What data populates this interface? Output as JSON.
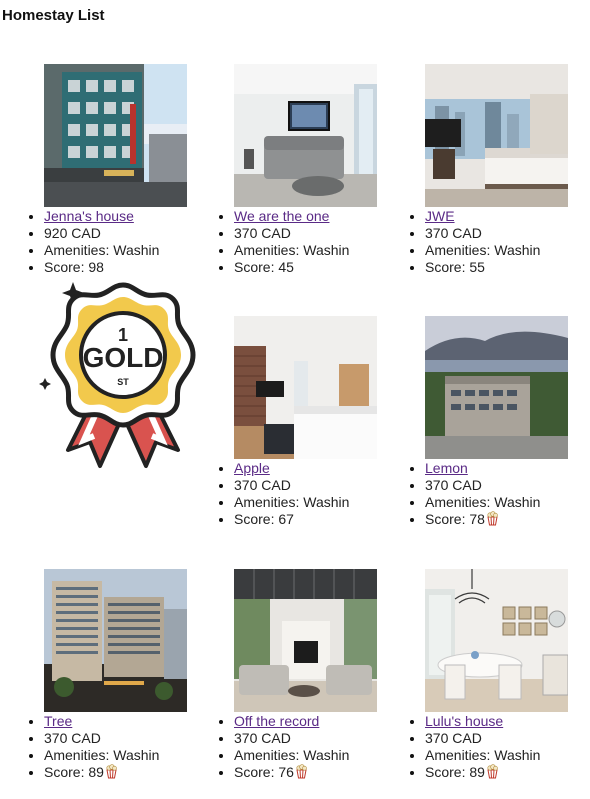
{
  "page": {
    "title": "Homestay List"
  },
  "listings": [
    {
      "name": "Jenna's house",
      "price": "920 CAD",
      "amenities": "Amenities: Washin",
      "score": "Score: 98",
      "badge": false,
      "image": "storefront-building"
    },
    {
      "name": "We are the one",
      "price": "370 CAD",
      "amenities": "Amenities: Washin",
      "score": "Score: 45",
      "badge": false,
      "image": "living-room"
    },
    {
      "name": "JWE",
      "price": "370 CAD",
      "amenities": "Amenities: Washin",
      "score": "Score: 55",
      "badge": false,
      "image": "bedroom-city-view"
    },
    {
      "name": "Apple",
      "price": "370 CAD",
      "amenities": "Amenities: Washin",
      "score": "Score: 67",
      "badge": false,
      "image": "bedroom-brick"
    },
    {
      "name": "Lemon",
      "price": "370 CAD",
      "amenities": "Amenities: Washin",
      "score": "Score: 78",
      "badge": true,
      "image": "aerial-building"
    },
    {
      "name": "Tree",
      "price": "370 CAD",
      "amenities": "Amenities: Washin",
      "score": "Score: 89",
      "badge": true,
      "image": "hotel-tower"
    },
    {
      "name": "Off the record",
      "price": "370 CAD",
      "amenities": "Amenities: Washin",
      "score": "Score: 76",
      "badge": true,
      "image": "modern-living-room"
    },
    {
      "name": "Lulu's house",
      "price": "370 CAD",
      "amenities": "Amenities: Washin",
      "score": "Score: 89",
      "badge": true,
      "image": "dining-room"
    }
  ],
  "medal": {
    "line1": "1",
    "line2": "GOLD",
    "line3": "ST"
  },
  "colors": {
    "link": "#5a2a86",
    "gold": "#f2c94c",
    "ribbon": "#d9534f"
  }
}
